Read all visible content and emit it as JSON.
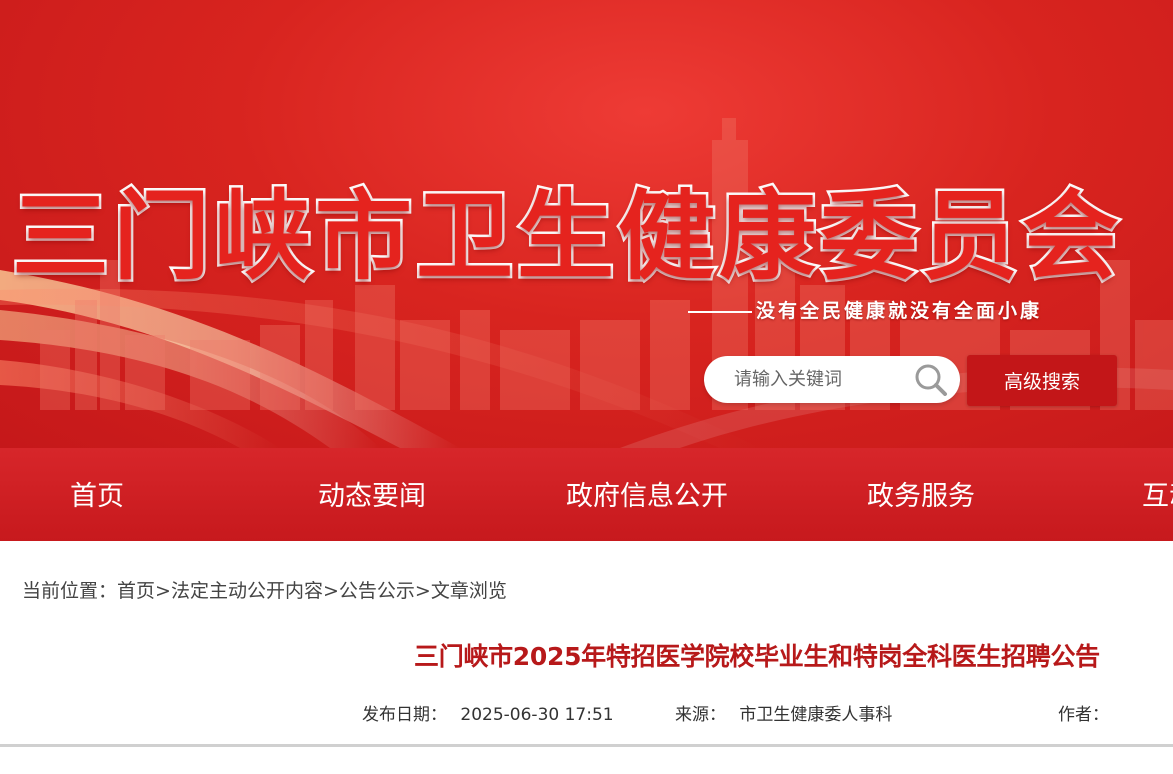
{
  "header": {
    "site_title": "三门峡市卫生健康委员会",
    "slogan": "没有全民健康就没有全面小康",
    "search": {
      "placeholder": "请输入关键词"
    },
    "advanced_search_label": "高级搜索"
  },
  "nav": {
    "items": [
      "首页",
      "动态要闻",
      "政府信息公开",
      "政务服务",
      "互动"
    ]
  },
  "breadcrumb": {
    "prefix": "当前位置：",
    "items": [
      "首页",
      "法定主动公开内容",
      "公告公示",
      "文章浏览"
    ],
    "separator": ">"
  },
  "article": {
    "title": "三门峡市2025年特招医学院校毕业生和特岗全科医生招聘公告",
    "publish_label": "发布日期：",
    "publish_date": "2025-06-30 17:51",
    "source_label": "来源：",
    "source": "市卫生健康委人事科",
    "author_label": "作者："
  },
  "colors": {
    "banner_red": "#d8241f",
    "nav_red": "#c7191d",
    "title_red": "#b7191a",
    "button_red": "#c31618"
  }
}
